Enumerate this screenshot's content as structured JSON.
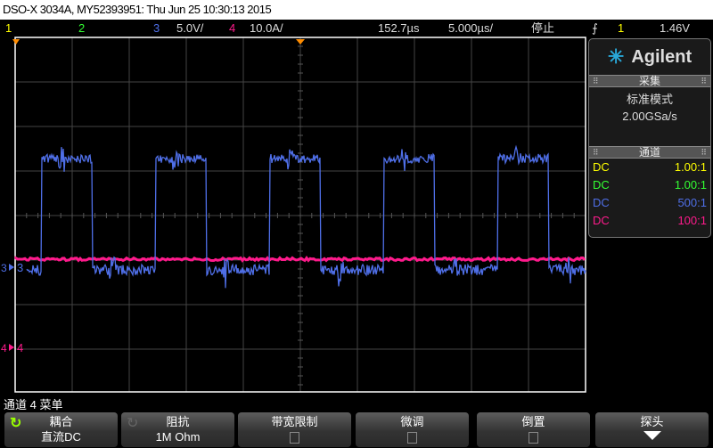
{
  "title": "DSO-X 3034A, MY52393951: Thu Jun 25 10:30:13 2015",
  "status": {
    "ch1": "1",
    "ch2": "2",
    "ch3": "3",
    "ch3_scale": "5.0V/",
    "ch4": "4",
    "ch4_scale": "10.0A/",
    "delay": "152.7µs",
    "timebase": "5.000µs/",
    "run_state": "停止",
    "trigger_icon": "rising-edge-icon",
    "trigger_source": "1",
    "trigger_level": "1.46V"
  },
  "colors": {
    "ch1": "#ffff00",
    "ch2": "#33ff33",
    "ch3": "#4f6fe8",
    "ch4": "#ff1a8c",
    "grid": "#444444"
  },
  "markers": {
    "ch3": "3",
    "ch4": "4"
  },
  "panel": {
    "brand": "Agilent",
    "acq_header": "采集",
    "acq_mode": "标准模式",
    "sample_rate": "2.00GSa/s",
    "ch_header": "通道",
    "channels": [
      {
        "coupling": "DC",
        "probe": "1.00:1"
      },
      {
        "coupling": "DC",
        "probe": "1.00:1"
      },
      {
        "coupling": "DC",
        "probe": "500:1"
      },
      {
        "coupling": "DC",
        "probe": "100:1"
      }
    ]
  },
  "menu_title": "通道 4 菜单",
  "softkeys": [
    {
      "label": "耦合",
      "value": "直流DC"
    },
    {
      "label": "阻抗",
      "value": "1M Ohm"
    },
    {
      "label": "带宽限制",
      "value": ""
    },
    {
      "label": "微调",
      "value": ""
    },
    {
      "label": "倒置",
      "value": ""
    },
    {
      "label": "探头",
      "value": ""
    }
  ]
}
